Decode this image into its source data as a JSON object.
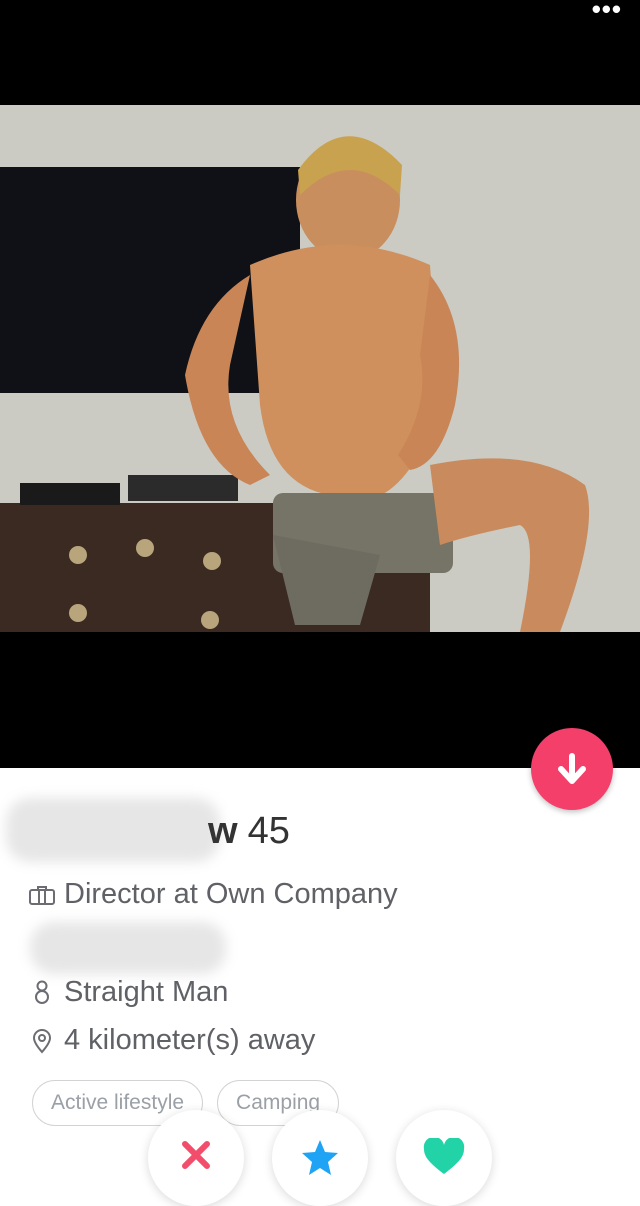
{
  "profile": {
    "name_suffix": "w",
    "age": "45",
    "job": "Director at Own Company",
    "orientation": "Straight Man",
    "distance": "4 kilometer(s) away"
  },
  "tags": [
    "Active lifestyle",
    "Camping"
  ],
  "colors": {
    "accent": "#f43f6b",
    "dislike": "#f24e6b",
    "superlike": "#1fa3f5",
    "like": "#22d3a7"
  },
  "icons": {
    "more": "more-dots-icon",
    "scroll": "arrow-down-icon",
    "job": "briefcase-icon",
    "orientation": "gender-icon",
    "distance": "location-pin-icon",
    "dislike": "x-icon",
    "superlike": "star-icon",
    "like": "heart-icon"
  }
}
